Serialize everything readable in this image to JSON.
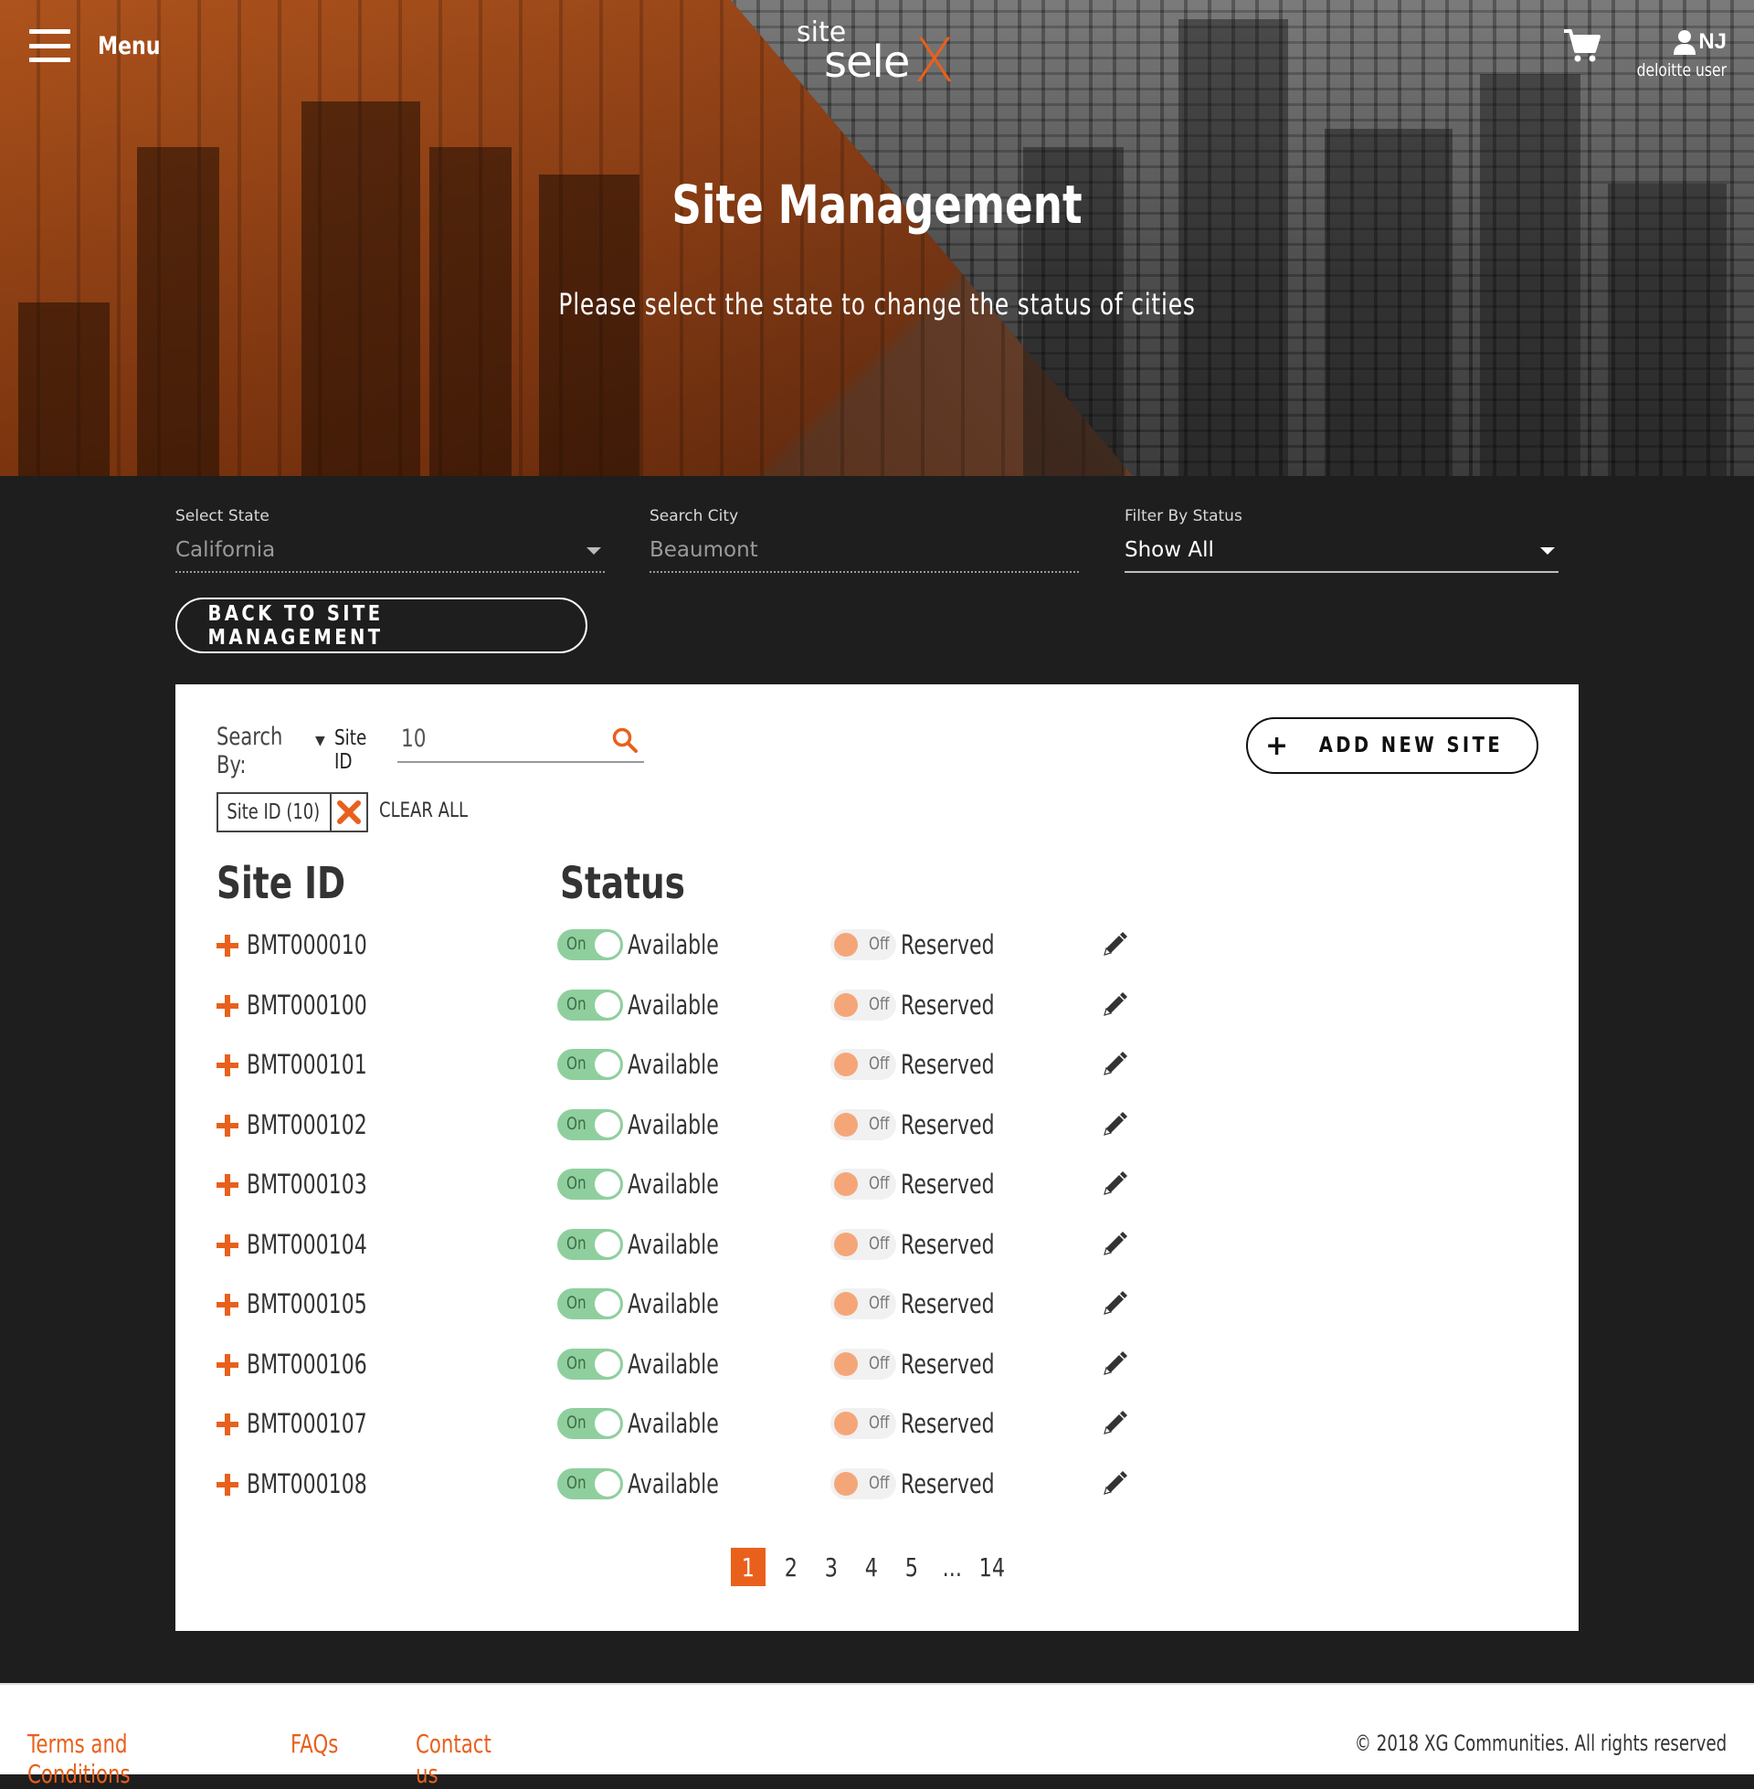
{
  "header": {
    "menu_label": "Menu",
    "logo": {
      "site": "site",
      "sele": "sele",
      "x": "X"
    },
    "user_initials": "NJ",
    "user_name": "deloitte user"
  },
  "hero": {
    "title": "Site Management",
    "subtitle": "Please select the state to change the status of cities"
  },
  "filters": {
    "state": {
      "label": "Select State",
      "value": "California"
    },
    "city": {
      "label": "Search City",
      "value": "Beaumont"
    },
    "status": {
      "label": "Filter By Status",
      "value": "Show All"
    }
  },
  "back_button": "BACK TO SITE MANAGEMENT",
  "panel": {
    "search_by_label": "Search By:",
    "search_by_field": "Site ID",
    "search_value": "10",
    "add_button": "ADD NEW SITE",
    "chip_label": "Site ID (10)",
    "clear_all": "CLEAR ALL",
    "col_site_id": "Site ID",
    "col_status": "Status",
    "on_label": "On",
    "off_label": "Off",
    "available_label": "Available",
    "reserved_label": "Reserved",
    "rows": [
      "BMT000010",
      "BMT000100",
      "BMT000101",
      "BMT000102",
      "BMT000103",
      "BMT000104",
      "BMT000105",
      "BMT000106",
      "BMT000107",
      "BMT000108"
    ],
    "pagination": [
      "1",
      "2",
      "3",
      "4",
      "5",
      "...",
      "14"
    ],
    "current_page": "1"
  },
  "footer": {
    "links": [
      "Terms and Conditions",
      "FAQs",
      "Contact us"
    ],
    "copyright": "© 2018 XG Communities. All rights reserved"
  },
  "colors": {
    "accent": "#e8601c",
    "toggle_on": "#8fcf9e",
    "toggle_off_knob": "#f5a679",
    "dark_bg": "#1e1e1e"
  }
}
